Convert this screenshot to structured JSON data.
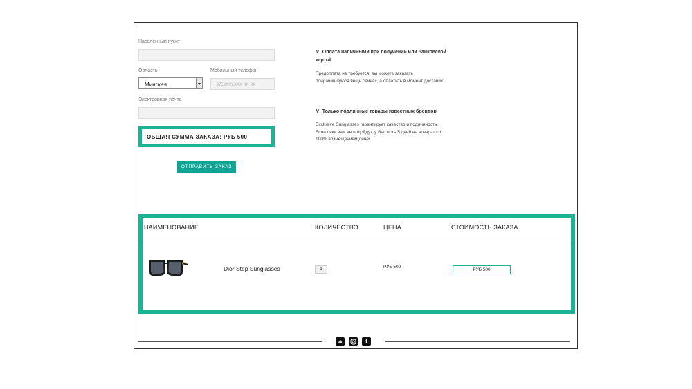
{
  "form": {
    "city_label": "Населенный пункт",
    "city_value": "",
    "region_label": "Область",
    "region_value": "Минская",
    "phone_label": "Мобильный телефон",
    "phone_placeholder": "+375 (XX) XXX XX XX",
    "email_label": "Электронная почта",
    "email_value": "",
    "total_text": "ОБЩАЯ СУММА ЗАКАЗА: РУБ 500",
    "submit_label": "ОТПРАВИТЬ ЗАКАЗ"
  },
  "info": [
    {
      "title": "Оплата наличными при получении или банковской картой",
      "body": "Предоплата не требуется: вы можете заказать понравившуюся вещь сейчас, а оплатить в момент доставки."
    },
    {
      "title": "Только подлинные товары известных брендов",
      "body": "Exclusive Sunglasses гарантирует качество и подлинность. Если очки вам не подойдут, у Вас есть 5 дней на возврат со 100% возмещением денег."
    }
  ],
  "table": {
    "headers": [
      "НАИМЕНОВАНИЕ",
      "КОЛИЧЕСТВО",
      "ЦЕНА",
      "СТОИМОСТЬ ЗАКАЗА"
    ],
    "rows": [
      {
        "name": "Dior Step Sunglasses",
        "quantity": "1",
        "price": "РУБ 500",
        "cost": "РУБ 500"
      }
    ]
  },
  "footer": {
    "social": [
      {
        "icon": "vk-icon",
        "glyph": "vk"
      },
      {
        "icon": "instagram-icon",
        "glyph": ""
      },
      {
        "icon": "facebook-icon",
        "glyph": "f"
      }
    ]
  },
  "colors": {
    "accent": "#1ab394",
    "button": "#11a596"
  }
}
